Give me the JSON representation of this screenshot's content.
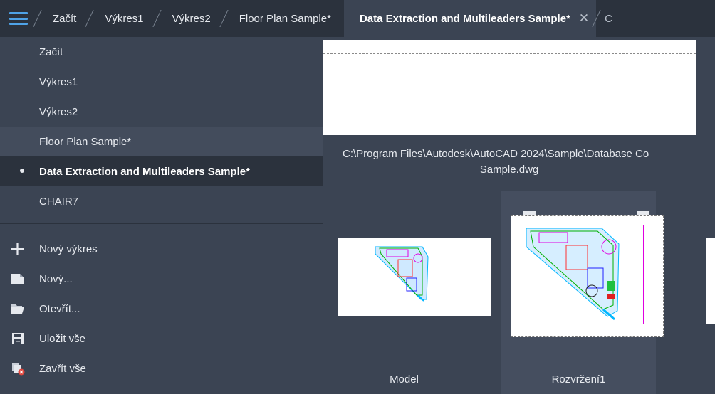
{
  "tabs": [
    {
      "label": "Začít"
    },
    {
      "label": "Výkres1"
    },
    {
      "label": "Výkres2"
    },
    {
      "label": "Floor Plan Sample*"
    },
    {
      "label": "Data Extraction and Multileaders Sample*",
      "close": "✕"
    },
    {
      "label": "C"
    }
  ],
  "documents": [
    {
      "label": "Začít"
    },
    {
      "label": "Výkres1"
    },
    {
      "label": "Výkres2"
    },
    {
      "label": "Floor Plan Sample*"
    },
    {
      "label": "Data Extraction and Multileaders Sample*"
    },
    {
      "label": "CHAIR7"
    }
  ],
  "actions": [
    {
      "label": "Nový výkres",
      "icon": "plus-icon"
    },
    {
      "label": "Nový...",
      "icon": "new-file-icon"
    },
    {
      "label": "Otevřít...",
      "icon": "open-folder-icon"
    },
    {
      "label": "Uložit vše",
      "icon": "save-all-icon"
    },
    {
      "label": "Zavřít vše",
      "icon": "close-all-icon"
    }
  ],
  "preview": {
    "path_line1": "C:\\Program Files\\Autodesk\\AutoCAD 2024\\Sample\\Database Co",
    "path_line2": "Sample.dwg"
  },
  "layouts": [
    {
      "label": "Model"
    },
    {
      "label": "Rozvržení1"
    }
  ],
  "colors": {
    "accent": "#4fa3e8",
    "panel": "#3b4453",
    "bar": "#2b323d"
  }
}
